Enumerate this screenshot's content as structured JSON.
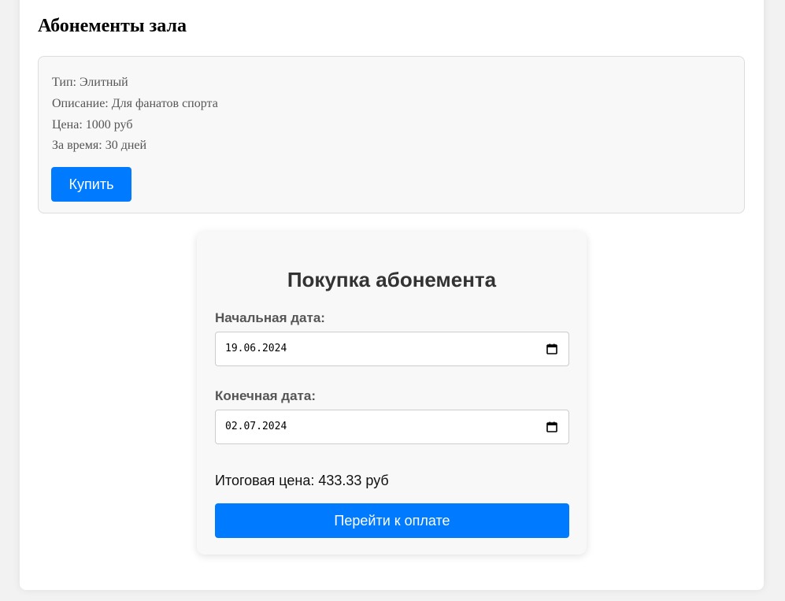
{
  "page": {
    "title": "Абонементы зала"
  },
  "membership": {
    "type_line": "Тип: Элитный",
    "description_line": "Описание: Для фанатов спорта",
    "price_line": "Цена: 1000 руб",
    "duration_line": "За время: 30 дней",
    "buy_label": "Купить"
  },
  "purchase": {
    "title": "Покупка абонемента",
    "start_label": "Начальная дата:",
    "start_value": "19.06.2024",
    "end_label": "Конечная дата:",
    "end_value": "02.07.2024",
    "total_line": "Итоговая цена: 433.33 руб",
    "pay_label": "Перейти к оплате",
    "icons": {
      "start": "calendar-icon",
      "end": "calendar-icon"
    }
  },
  "colors": {
    "accent": "#007bff",
    "card_bg": "#f8f8f8"
  }
}
